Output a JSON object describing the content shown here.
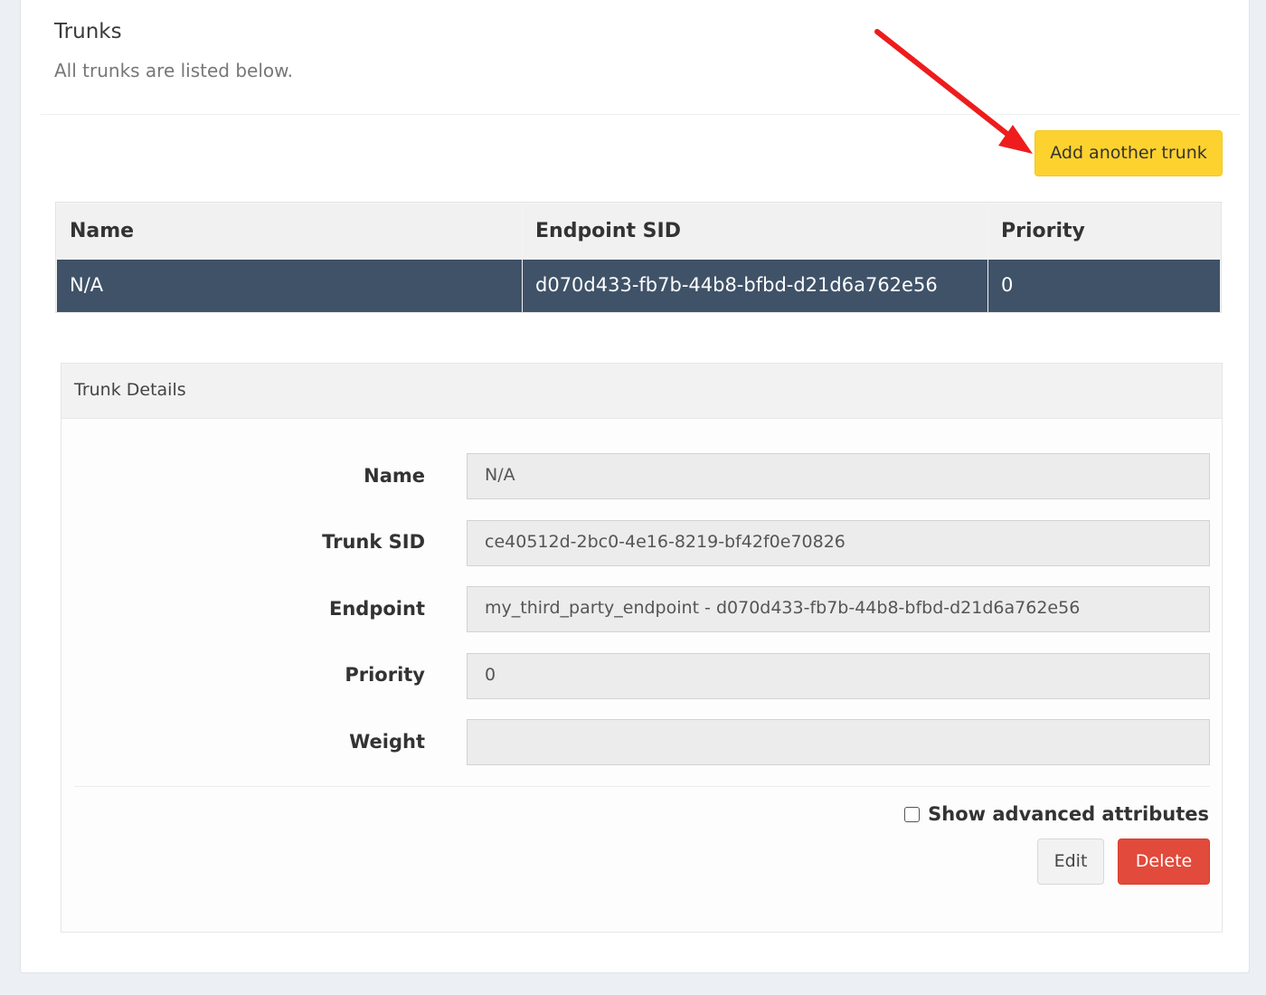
{
  "header": {
    "title": "Trunks",
    "subtitle": "All trunks are listed below."
  },
  "actions": {
    "add_trunk_label": "Add another trunk"
  },
  "table": {
    "columns": [
      "Name",
      "Endpoint SID",
      "Priority"
    ],
    "rows": [
      [
        "N/A",
        "d070d433-fb7b-44b8-bfbd-d21d6a762e56",
        "0"
      ]
    ]
  },
  "details": {
    "title": "Trunk Details",
    "fields": [
      {
        "label": "Name",
        "value": "N/A"
      },
      {
        "label": "Trunk SID",
        "value": "ce40512d-2bc0-4e16-8219-bf42f0e70826"
      },
      {
        "label": "Endpoint",
        "value": "my_third_party_endpoint - d070d433-fb7b-44b8-bfbd-d21d6a762e56"
      },
      {
        "label": "Priority",
        "value": "0"
      },
      {
        "label": "Weight",
        "value": ""
      }
    ],
    "show_advanced_label": "Show advanced attributes",
    "show_advanced_checked": false,
    "edit_label": "Edit",
    "delete_label": "Delete"
  },
  "colors": {
    "accent_yellow": "#fdd22e",
    "selected_row": "#3f5268",
    "danger": "#e24a3b",
    "annotation_arrow": "#ee1c1c"
  }
}
